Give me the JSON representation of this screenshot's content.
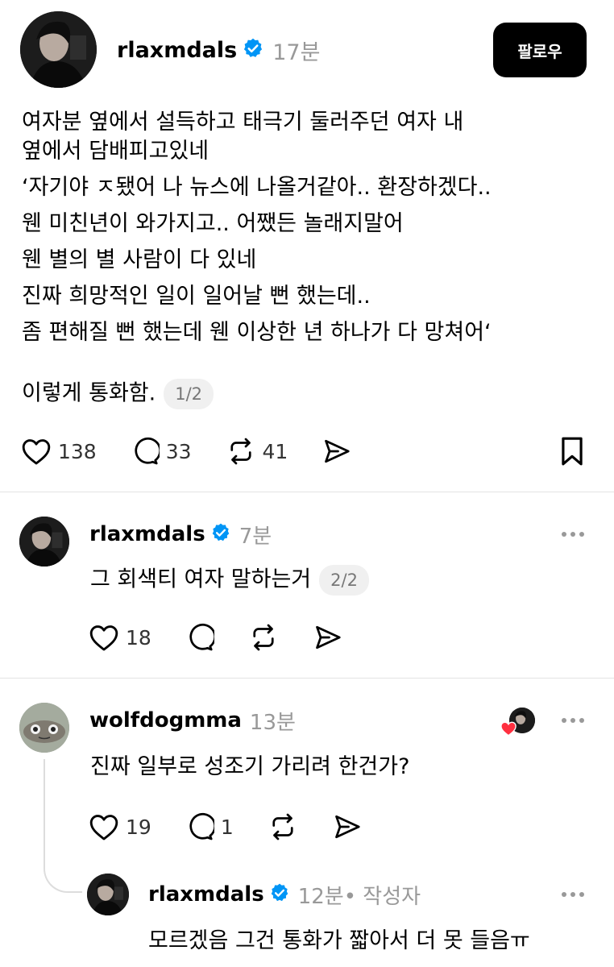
{
  "main_post": {
    "username": "rlaxmdals",
    "time": "17분",
    "follow_label": "팔로우",
    "lines": [
      "여자분 옆에서 설득하고 태극기 둘러주던 여자 내",
      "옆에서 담배피고있네",
      "‘자기야 ㅈ됐어 나 뉴스에 나올거같아.. 환장하겠다..",
      "웬 미친년이 와가지고.. 어쨌든 놀래지말어",
      "웬 별의 별 사람이 다 있네",
      "진짜 희망적인 일이 일어날 뻔 했는데..",
      "좀 편해질 뻔 했는데 웬 이상한 년 하나가 다 망쳐어‘"
    ],
    "last_line": "이렇게 통화함.",
    "pager": "1/2",
    "likes": "138",
    "comments": "33",
    "reposts": "41"
  },
  "reply1": {
    "username": "rlaxmdals",
    "time": "7분",
    "text": "그 회색티 여자 말하는거",
    "pager": "2/2",
    "likes": "18"
  },
  "reply2": {
    "username": "wolfdogmma",
    "time": "13분",
    "text": "진짜 일부로 성조기 가리려 한건가?",
    "likes": "19",
    "comments": "1"
  },
  "reply3": {
    "username": "rlaxmdals",
    "time": "12분",
    "author_tag": " • 작성자",
    "text": "모르겠음 그건 통화가 짧아서 더 못 들음ㅠ"
  },
  "colors": {
    "verified": "#0095f6",
    "heart": "#ff3040"
  }
}
